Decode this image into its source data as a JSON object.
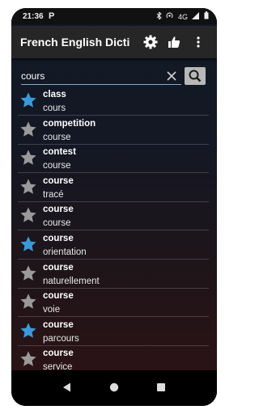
{
  "status": {
    "time": "21:36",
    "app_badge": "P",
    "indicators": [
      "bluetooth-icon",
      "hotspot-icon",
      "4G",
      "signal-icon",
      "battery-icon"
    ]
  },
  "appbar": {
    "title": "French English Dicti...",
    "icons": [
      "gear-icon",
      "thumbs-up-icon",
      "more-vert-icon"
    ]
  },
  "search": {
    "value": "cours",
    "placeholder": ""
  },
  "colors": {
    "star_favorite": "#3a9ad9",
    "star_default": "#9a9a9a"
  },
  "results": [
    {
      "term": "class",
      "translation": "cours",
      "favorite": true
    },
    {
      "term": "competition",
      "translation": "course",
      "favorite": false
    },
    {
      "term": "contest",
      "translation": "course",
      "favorite": false
    },
    {
      "term": "course",
      "translation": "tracé",
      "favorite": false
    },
    {
      "term": "course",
      "translation": "course",
      "favorite": false
    },
    {
      "term": "course",
      "translation": "orientation",
      "favorite": true
    },
    {
      "term": "course",
      "translation": "naturellement",
      "favorite": false
    },
    {
      "term": "course",
      "translation": "voie",
      "favorite": false
    },
    {
      "term": "course",
      "translation": "parcours",
      "favorite": true
    },
    {
      "term": "course",
      "translation": "service",
      "favorite": false
    }
  ]
}
